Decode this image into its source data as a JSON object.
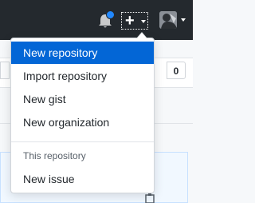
{
  "header": {
    "bell_icon": "bell-icon",
    "notification_color": "#2188ff",
    "plus_icon": "plus-icon",
    "avatar_icon": "avatar"
  },
  "page": {
    "count_value": "0"
  },
  "dropdown": {
    "items": [
      {
        "label": "New repository"
      },
      {
        "label": "Import repository"
      },
      {
        "label": "New gist"
      },
      {
        "label": "New organization"
      }
    ],
    "section_header": "This repository",
    "section_items": [
      {
        "label": "New issue"
      }
    ]
  },
  "colors": {
    "header_bg": "#24292e",
    "active_bg": "#0366d6"
  }
}
